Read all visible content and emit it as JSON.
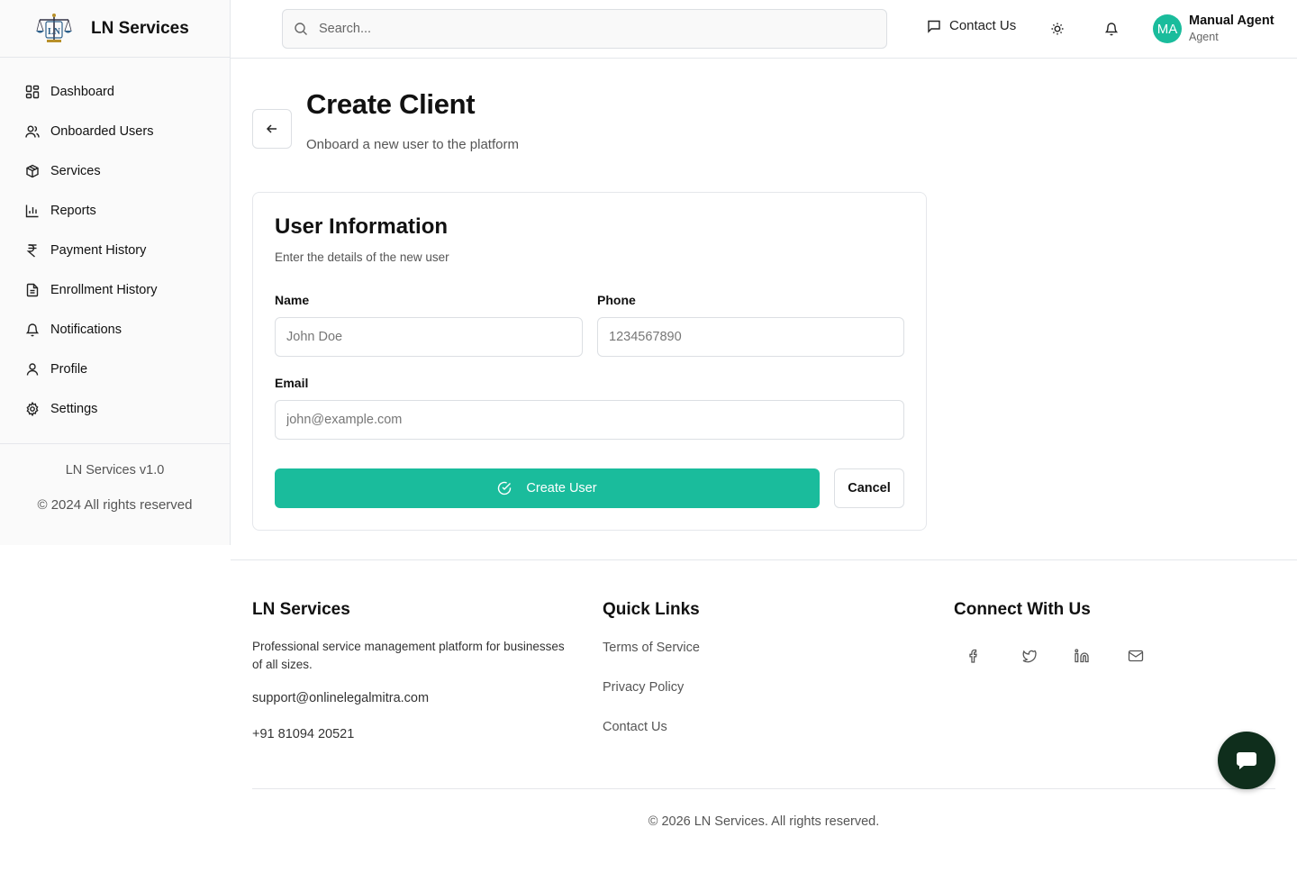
{
  "brand": {
    "name": "LN Services",
    "logo_icon": "scales-of-justice-logo"
  },
  "sidebar": {
    "items": [
      {
        "label": "Dashboard",
        "icon": "dashboard-icon"
      },
      {
        "label": "Onboarded Users",
        "icon": "users-icon"
      },
      {
        "label": "Services",
        "icon": "package-icon"
      },
      {
        "label": "Reports",
        "icon": "bar-chart-icon"
      },
      {
        "label": "Payment History",
        "icon": "rupee-icon"
      },
      {
        "label": "Enrollment History",
        "icon": "document-icon"
      },
      {
        "label": "Notifications",
        "icon": "bell-icon"
      },
      {
        "label": "Profile",
        "icon": "user-icon"
      },
      {
        "label": "Settings",
        "icon": "gear-icon"
      }
    ],
    "version": "LN Services v1.0",
    "copyright": "© 2024 All rights reserved"
  },
  "header": {
    "search_placeholder": "Search...",
    "contact_label": "Contact Us",
    "user": {
      "initials": "MA",
      "name": "Manual Agent",
      "role": "Agent"
    }
  },
  "page": {
    "title": "Create Client",
    "subtitle": "Onboard a new user to the platform"
  },
  "form": {
    "title": "User Information",
    "subtitle": "Enter the details of the new user",
    "name_label": "Name",
    "name_placeholder": "John Doe",
    "phone_label": "Phone",
    "phone_placeholder": "1234567890",
    "email_label": "Email",
    "email_placeholder": "john@example.com",
    "submit_label": "Create User",
    "cancel_label": "Cancel"
  },
  "footer": {
    "about_title": "LN Services",
    "about_desc": "Professional service management platform for businesses of all sizes.",
    "email": "support@onlinelegalmitra.com",
    "phone": "+91 81094 20521",
    "links_title": "Quick Links",
    "links": [
      "Terms of Service",
      "Privacy Policy",
      "Contact Us"
    ],
    "connect_title": "Connect With Us",
    "social_icons": [
      "facebook-icon",
      "twitter-icon",
      "linkedin-icon",
      "mail-icon"
    ],
    "copyright": "© 2026 LN Services. All rights reserved."
  },
  "colors": {
    "accent": "#1abc9c",
    "chat_button": "#0f2e1c",
    "border": "#e5e7eb"
  }
}
